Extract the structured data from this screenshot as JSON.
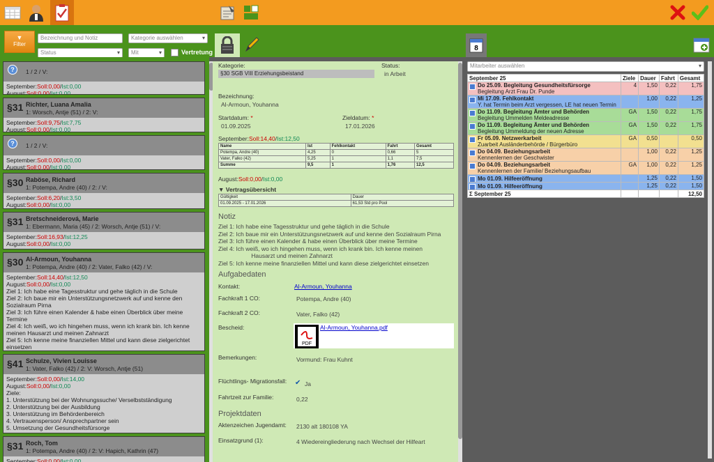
{
  "topbar": {
    "icons": [
      "calendar-icon",
      "person-icon",
      "checklist-icon",
      "notepad-icon",
      "layout-icon"
    ]
  },
  "filter": {
    "button_label": "Filter",
    "name_placeholder": "Bezeichnung und Notiz",
    "category_placeholder": "Kategorie auswählen",
    "status_placeholder": "Status",
    "with_placeholder": "Mit",
    "substitute_label": "Vertretung"
  },
  "cards": [
    {
      "sec": "",
      "name": "",
      "sub": "1 / 2 / V:",
      "lines": [
        [
          "September:",
          "Soll:0,00",
          "Ist:0,00"
        ],
        [
          "August:",
          "Soll:0,00",
          "Ist:0,00"
        ]
      ]
    },
    {
      "sec": "§31",
      "name": "Richter, Luana Amalia",
      "sub": "1: Worsch, Antje (51) / 2: V:",
      "lines": [
        [
          "September:",
          "Soll:9,75",
          "Ist:7,75"
        ],
        [
          "August:",
          "Soll:0,00",
          "Ist:0,00"
        ]
      ]
    },
    {
      "sec": "",
      "name": "",
      "sub": "1 / 2 / V:",
      "lines": [
        [
          "September:",
          "Soll:0,00",
          "Ist:0,00"
        ],
        [
          "August:",
          "Soll:0,00",
          "Ist:0,00"
        ]
      ]
    },
    {
      "sec": "§30",
      "name": "Raböse, Richard",
      "sub": "1: Potempa, Andre (40) / 2: / V:",
      "lines": [
        [
          "September:",
          "Soll:6,20",
          "Ist:3,50"
        ],
        [
          "August:",
          "Soll:0,00",
          "Ist:0,00"
        ]
      ]
    },
    {
      "sec": "§31",
      "name": "Bretschneiderová, Marie",
      "sub": "1: Ebermann, Maria (45) / 2: Worsch, Antje (51) / V:",
      "lines": [
        [
          "September:",
          "Soll:16,93",
          "Ist:12,25"
        ],
        [
          "August:",
          "Soll:0,00",
          "Ist:0,00"
        ]
      ]
    },
    {
      "sec": "§30",
      "name": "Al-Armoun, Youhanna",
      "sub": "1: Potempa, Andre (40) / 2: Vater, Falko (42) / V:",
      "lines": [
        [
          "September:",
          "Soll:14,40",
          "Ist:12,50"
        ],
        [
          "August:",
          "Soll:0,00",
          "Ist:0,00"
        ]
      ],
      "notes": [
        "Ziel 1: Ich habe eine Tagesstruktur und gehe täglich in die Schule",
        "Ziel 2: Ich baue mir ein Unterstützungsnetzwerk auf und kenne den Sozialraum Pirna",
        "Ziel 3: Ich führe einen Kalender & habe einen Überblick über meine Termine",
        "Ziel 4: Ich weiß, wo ich hingehen muss, wenn ich krank bin. Ich kenne meinen                    Hausarzt und meinen Zahnarzt",
        "Ziel 5: Ich kenne meine finanziellen Mittel und kann diese zielgerichtet einsetzen"
      ]
    },
    {
      "sec": "§41",
      "name": "Schulze, Vivien Louisse",
      "sub": "1: Vater, Falko (42) / 2: V: Worsch, Antje (51)",
      "lines": [
        [
          "September:",
          "Soll:0,00",
          "Ist:14,00"
        ],
        [
          "August:",
          "Soll:0,00",
          "Ist:0,00"
        ]
      ],
      "notes": [
        "Ziele:",
        "1. Unterstützung bei der Wohnungssuche/ Verselbstständigung",
        "2. Unterstützung bei der Ausbildung",
        "3. Unterstützung im Behördenbereich",
        "4. Vertrauensperson/ Ansprechpartner sein",
        "5. Umsetzung der Gesundheitsfürsorge"
      ]
    },
    {
      "sec": "§31",
      "name": "Roch, Tom",
      "sub": "1: Potempa, Andre (40) / 2: V: Hapich, Kathrin (47)",
      "lines": [
        [
          "September:",
          "Soll:0,00",
          "Ist:0,00"
        ]
      ]
    }
  ],
  "detail": {
    "kategorie_label": "Kategorie:",
    "kategorie_value": "§30 SGB VIII Erziehungsbeistand",
    "status_label": "Status:",
    "status_value": "in Arbeit",
    "bez_label": "Bezeichnung:",
    "bez_value": "Al-Armoun, Youhanna",
    "start_label": "Startdatum:",
    "start_value": "01.09.2025",
    "ziel_label": "Zieldatum:",
    "ziel_value": "17.01.2026",
    "sept_line": [
      "September:",
      "Soll:14,40",
      "Ist:12,50"
    ],
    "mini_header": [
      "Name",
      "Ist",
      "Fehlkontakt",
      "Fahrt",
      "Gesamt"
    ],
    "mini_rows": [
      [
        "Potempa, Andre (40)",
        "4,25",
        "0",
        "0,66",
        "5"
      ],
      [
        "Vater, Falko (42)",
        "5,25",
        "1",
        "1,1",
        "7,5"
      ],
      [
        "Summe",
        "9,5",
        "1",
        "1,76",
        "12,5"
      ]
    ],
    "aug_line": [
      "August:",
      "Soll:0,00",
      "Ist:0,00"
    ],
    "vertrag_label": "▼ Vertragsübersicht",
    "vertrag_header": [
      "Gültigkeit",
      "Dauer"
    ],
    "vertrag_row": [
      "01.09.2025 - 17.01.2026",
      "61,53 Std pro Pool"
    ],
    "notiz_heading": "Notiz",
    "notiz": [
      "Ziel 1: Ich habe eine Tagesstruktur und gehe täglich in die Schule",
      "Ziel 2: Ich baue mir ein Unterstützungsnetzwerk auf und kenne den Sozialraum Pirna",
      "Ziel 3: Ich führe einen Kalender & habe einen Überblick über meine Termine",
      "Ziel 4: Ich weiß, wo ich hingehen muss, wenn ich krank bin. Ich kenne meinen",
      "                    Hausarzt und meinen Zahnarzt",
      "Ziel 5: Ich kenne meine finanziellen Mittel und kann diese zielgerichtet einsetzen"
    ],
    "aufgaben_heading": "Aufgabedaten",
    "kontakt_label": "Kontakt:",
    "kontakt_value": "Al-Armoun, Youhanna",
    "fk1_label": "Fachkraft 1 CO:",
    "fk1_value": "Potempa, Andre (40)",
    "fk2_label": "Fachkraft 2 CO:",
    "fk2_value": "Vater, Falko (42)",
    "bescheid_label": "Bescheid:",
    "bescheid_file": "Al-Armoun, Youhanna.pdf",
    "bem_label": "Bemerkungen:",
    "bem_value": "Vormund: Frau Kuhnt",
    "fluecht_label": "Flüchtlings- Migrationsfall:",
    "fluecht_value": "Ja",
    "fahrt_label": "Fahrtzeit zur Familie:",
    "fahrt_value": "0,22",
    "projekt_heading": "Projektdaten",
    "akten_label": "Aktenzeichen Jugendamt:",
    "akten_value": "2130 alt 180108 YA",
    "einsatz_label": "Einsatzgrund (1):",
    "einsatz_value": "4 Wiedereingliederung nach Wechsel der Hilfeart"
  },
  "right": {
    "mitarbeiter_placeholder": "Mitarbeiter auswählen",
    "month": "September 25",
    "cols": [
      "Ziele",
      "Dauer",
      "Fahrt",
      "Gesamt"
    ],
    "rows": [
      {
        "color": "#f4c0c0",
        "title": "Do 25.09. Begleitung Gesundheitsfürsorge",
        "sub": "Begleitung Arzt Frau Dr. Punde",
        "ziele": "4",
        "dauer": "1,50",
        "fahrt": "0,22",
        "gesamt": "1,75"
      },
      {
        "color": "#8ab4ee",
        "title": "Mi 17.09. Fehlkontakt",
        "sub": "Y. hat Termin beim Arzt vergessen, LE hat neuen Termin",
        "ziele": "",
        "dauer": "1,00",
        "fahrt": "0,22",
        "gesamt": "1,25"
      },
      {
        "color": "#a8dc98",
        "title": "Do 11.09. Begleitung Ämter und Behörden",
        "sub": "Begleitung Ummelden Meldeadresse",
        "ziele": "GA",
        "dauer": "1,50",
        "fahrt": "0,22",
        "gesamt": "1,75"
      },
      {
        "color": "#a8dc98",
        "title": "Do 11.09. Begleitung Ämter und Behörden",
        "sub": "Begleitung Ummeldung der neuen Adresse",
        "ziele": "GA",
        "dauer": "1,50",
        "fahrt": "0,22",
        "gesamt": "1,75"
      },
      {
        "color": "#f2e090",
        "title": "Fr 05.09. Netzwerkarbeit",
        "sub": "Zuarbeit Ausländerbehörde / Bürgerbüro",
        "ziele": "GA",
        "dauer": "0,50",
        "fahrt": "",
        "gesamt": "0,50"
      },
      {
        "color": "#f7d0a8",
        "title": "Do 04.09. Beziehungsarbeit",
        "sub": "Kennenlernen der Geschwister",
        "ziele": "",
        "dauer": "1,00",
        "fahrt": "0,22",
        "gesamt": "1,25"
      },
      {
        "color": "#f7d0a8",
        "title": "Do 04.09. Beziehungsarbeit",
        "sub": "Kennenlernen der Familie/ Beziehungsaufbau",
        "ziele": "GA",
        "dauer": "1,00",
        "fahrt": "0,22",
        "gesamt": "1,25"
      },
      {
        "color": "#8ab4ee",
        "title": "Mo 01.09. Hilfeeröffnung",
        "sub": "",
        "ziele": "",
        "dauer": "1,25",
        "fahrt": "0,22",
        "gesamt": "1,50"
      },
      {
        "color": "#8ab4ee",
        "title": "Mo 01.09. Hilfeeröffnung",
        "sub": "",
        "ziele": "",
        "dauer": "1,25",
        "fahrt": "0,22",
        "gesamt": "1,50"
      }
    ],
    "sum_label": "Σ",
    "sum_month": "September 25",
    "sum_total": "12,50"
  }
}
